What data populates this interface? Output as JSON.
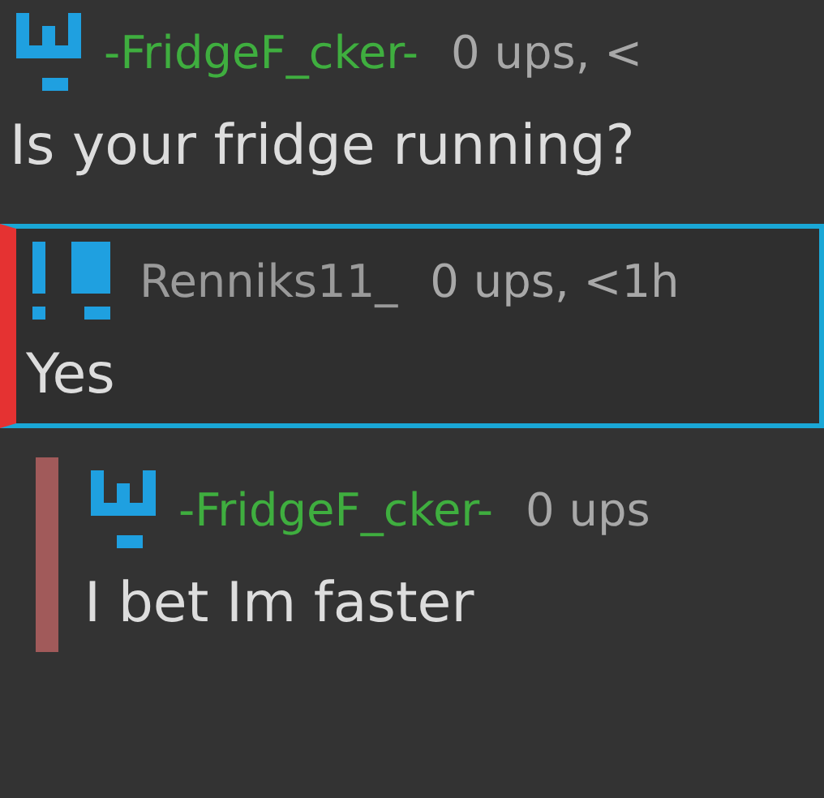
{
  "comments": [
    {
      "kind": "fork",
      "username": "-FridgeF_cker-",
      "color": "#3fae3f",
      "meta": "0 ups, <",
      "text": "Is your fridge running?",
      "highlighted": false,
      "reply": false
    },
    {
      "kind": "bars",
      "username": "Renniks11_",
      "color": "#9a9a9a",
      "meta": "0 ups, <1h",
      "text": "Yes",
      "highlighted": true,
      "reply": false
    },
    {
      "kind": "fork",
      "username": "-FridgeF_cker-",
      "color": "#3fae3f",
      "meta": "0 ups",
      "text": "I bet Im faster",
      "highlighted": false,
      "reply": true
    }
  ]
}
